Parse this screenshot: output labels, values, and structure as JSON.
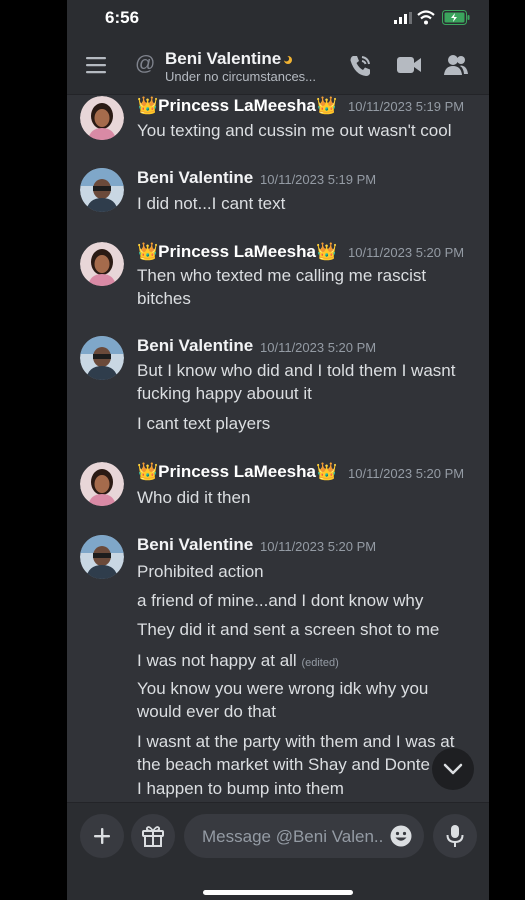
{
  "status_bar": {
    "time": "6:56"
  },
  "header": {
    "name": "Beni Valentine",
    "status": "Under no circumstances..."
  },
  "messages": [
    {
      "author": "👑Princess LaMeesha👑",
      "timestamp": "10/11/2023 5:19 PM",
      "lines": [
        "You texting and cussin me out wasn't cool"
      ]
    },
    {
      "author": "Beni Valentine",
      "timestamp": "10/11/2023 5:19 PM",
      "lines": [
        "I did not...I cant text"
      ]
    },
    {
      "author": "👑Princess LaMeesha👑",
      "timestamp": "10/11/2023 5:20 PM",
      "lines": [
        "Then who texted me calling me rascist bitches"
      ]
    },
    {
      "author": "Beni Valentine",
      "timestamp": "10/11/2023 5:20 PM",
      "lines": [
        "But I know who did and I told them I wasnt fucking happy abouut it",
        "I cant text players"
      ]
    },
    {
      "author": "👑Princess LaMeesha👑",
      "timestamp": "10/11/2023 5:20 PM",
      "lines": [
        "Who did it then"
      ]
    },
    {
      "author": "Beni Valentine",
      "timestamp": "10/11/2023 5:20 PM",
      "lines": [
        "Prohibited action",
        "a friend of mine...and I dont know why",
        "They did it and sent a screen shot to me",
        "I was not happy at all",
        "You know you were wrong idk why you would ever do that",
        "I wasnt at the party with them and I was at the beach market with Shay and Donte",
        "I happen to bump into them"
      ],
      "edited_label": "(edited)"
    }
  ],
  "composer": {
    "placeholder": "Message @Beni Valen..."
  },
  "icons": {
    "menu": "hamburger-menu-icon",
    "at": "at-sign-icon",
    "call": "phone-call-icon",
    "video": "video-camera-icon",
    "profile": "user-profile-icon",
    "add": "plus-icon",
    "gift": "gift-icon",
    "emoji": "emoji-icon",
    "mic": "microphone-icon",
    "scroll": "chevron-down-icon"
  },
  "colors": {
    "background": "#313338",
    "header": "#2b2d31",
    "text": "#dbdee1",
    "timestamp": "#949ba4",
    "battery": "#3ba55d"
  }
}
